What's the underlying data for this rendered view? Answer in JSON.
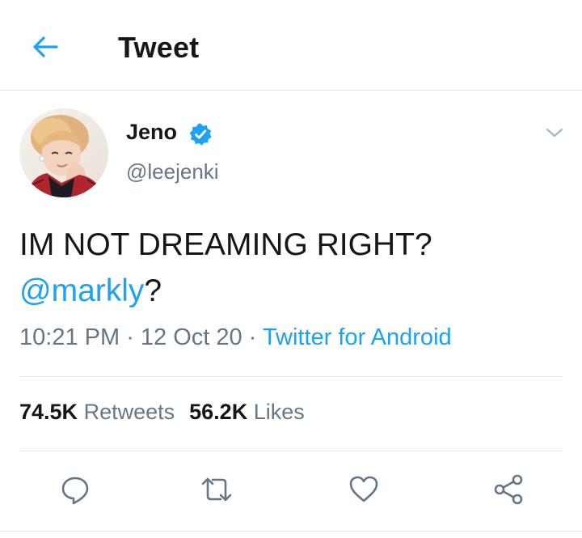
{
  "header": {
    "title": "Tweet",
    "back_icon": "arrow-left-icon"
  },
  "author": {
    "display_name": "Jeno",
    "username": "@leejenki",
    "verified": true
  },
  "tweet": {
    "line1": "IM NOT DREAMING RIGHT?",
    "mention": "@markly",
    "mention_suffix": "?"
  },
  "meta": {
    "time": "10:21 PM",
    "separator": " · ",
    "date": "12 Oct 20",
    "source": "Twitter for Android"
  },
  "stats": {
    "retweets_count": "74.5K",
    "retweets_label": "Retweets",
    "likes_count": "56.2K",
    "likes_label": "Likes"
  },
  "actions": [
    "reply-icon",
    "retweet-icon",
    "like-icon",
    "share-icon"
  ],
  "colors": {
    "accent": "#1da1f2",
    "text": "#14171a",
    "secondary": "#657786",
    "border": "#e1e8ed"
  }
}
